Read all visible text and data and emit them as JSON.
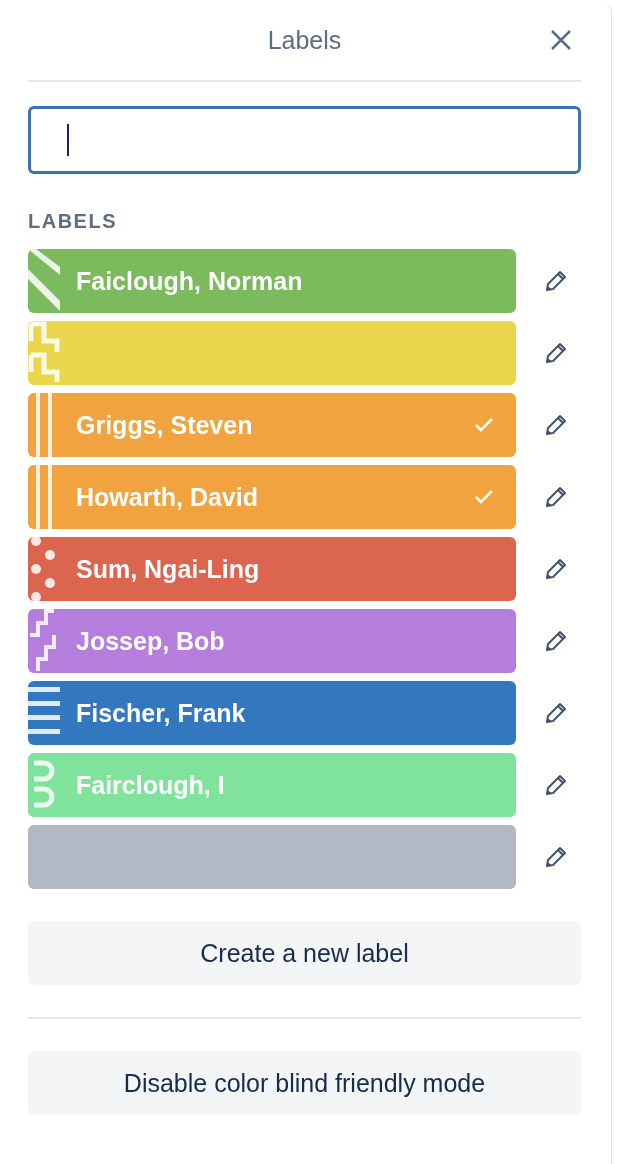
{
  "title": "Labels",
  "section_heading": "LABELS",
  "labels": [
    {
      "name": "Faiclough, Norman",
      "color": "#7bba5d",
      "kind": "diagonal",
      "checked": false
    },
    {
      "color": "#ead64a",
      "kind": "hooks",
      "checked": false
    },
    {
      "name": "Griggs, Steven",
      "color": "#f0a33f",
      "kind": "bars",
      "checked": true
    },
    {
      "name": "Howarth, David",
      "color": "#f0a33f",
      "kind": "bars",
      "checked": true
    },
    {
      "name": "Sum, Ngai-Ling",
      "color": "#dc6550",
      "kind": "dots",
      "checked": false
    },
    {
      "name": "Jossep, Bob",
      "color": "#b57ddc",
      "kind": "zigzag",
      "checked": false
    },
    {
      "name": "Fischer, Frank",
      "color": "#3377be",
      "kind": "lines",
      "checked": false
    },
    {
      "name": "Fairclough, I",
      "color": "#7fe39b",
      "kind": "loops",
      "checked": false
    },
    {
      "color": "#b3b9c4",
      "kind": "plain",
      "checked": false
    }
  ],
  "create_button": "Create a new label",
  "mode_button": "Disable color blind friendly mode"
}
